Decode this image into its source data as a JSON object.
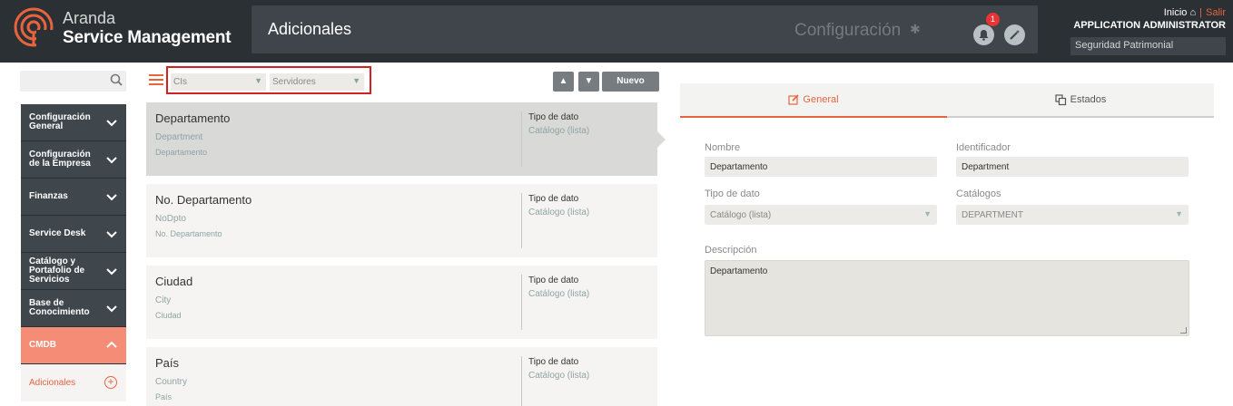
{
  "header": {
    "brand_line1": "Aranda",
    "brand_line2": "Service Management",
    "section_title": "Adicionales",
    "config_label": "Configuración",
    "notification_count": "1",
    "inicio_label": "Inicio",
    "salir_label": "Salir",
    "user_name": "APPLICATION ADMINISTRATOR",
    "tenant": "Seguridad Patrimonial",
    "accent_color": "#e8643f"
  },
  "sidebar": {
    "search_placeholder": "",
    "items": [
      {
        "label": "Configuración General"
      },
      {
        "label": "Configuración de la Empresa"
      },
      {
        "label": "Finanzas"
      },
      {
        "label": "Service Desk"
      },
      {
        "label": "Catálogo y Portafolio de Servicios"
      },
      {
        "label": "Base de Conocimiento"
      },
      {
        "label": "CMDB"
      }
    ],
    "subitem": {
      "label": "Adicionales"
    }
  },
  "filters": {
    "type_value": "CIs",
    "category_value": "Servidores",
    "new_button": "Nuevo"
  },
  "cards": [
    {
      "name": "Departamento",
      "english_name": "Department",
      "description": "Departamento",
      "type_label": "Tipo de dato",
      "type_value": "Catálogo (lista)"
    },
    {
      "name": "No. Departamento",
      "english_name": "NoDpto",
      "description": "No. Departamento",
      "type_label": "Tipo de dato",
      "type_value": "Catálogo (lista)"
    },
    {
      "name": "Ciudad",
      "english_name": "City",
      "description": "Ciudad",
      "type_label": "Tipo de dato",
      "type_value": "Catálogo (lista)"
    },
    {
      "name": "País",
      "english_name": "Country",
      "description": "País",
      "type_label": "Tipo de dato",
      "type_value": "Catálogo (lista)"
    }
  ],
  "detail": {
    "tabs": {
      "general": "General",
      "estados": "Estados"
    },
    "nombre_label": "Nombre",
    "nombre_value": "Departamento",
    "identificador_label": "Identificador",
    "identificador_value": "Department",
    "tipo_label": "Tipo de dato",
    "tipo_value": "Catálogo (lista)",
    "catalogos_label": "Catálogos",
    "catalogos_value": "DEPARTMENT",
    "descripcion_label": "Descripción",
    "descripcion_value": "Departamento"
  }
}
